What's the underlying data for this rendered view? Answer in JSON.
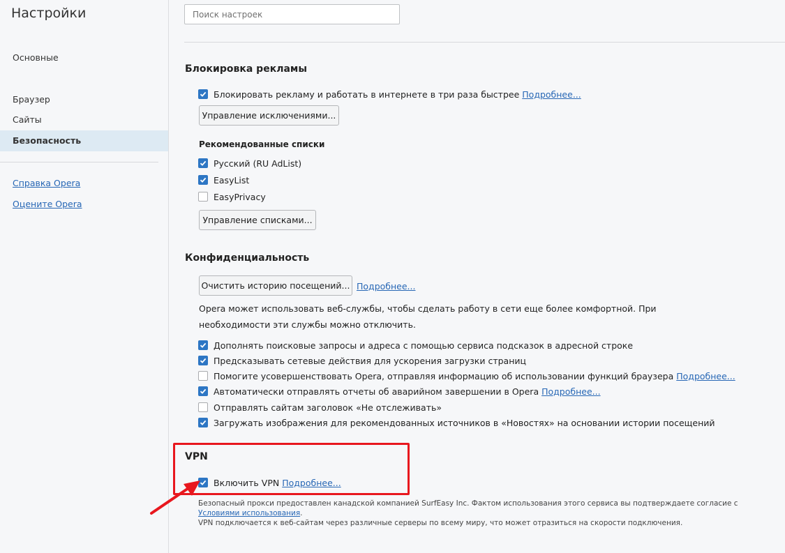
{
  "sidebar": {
    "title": "Настройки",
    "items": [
      {
        "label": "Основные"
      },
      {
        "label": "Браузер"
      },
      {
        "label": "Сайты"
      },
      {
        "label": "Безопасность",
        "active": true
      }
    ],
    "links": [
      {
        "label": "Справка Opera"
      },
      {
        "label": "Оцените Opera"
      }
    ]
  },
  "search": {
    "placeholder": "Поиск настроек",
    "value": ""
  },
  "adblock": {
    "title": "Блокировка рекламы",
    "block_ads": {
      "label": "Блокировать рекламу и работать в интернете в три раза быстрее",
      "checked": true,
      "link": "Подробнее..."
    },
    "manage_exceptions_button": "Управление исключениями...",
    "lists_title": "Рекомендованные списки",
    "lists": [
      {
        "label": "Русский (RU AdList)",
        "checked": true
      },
      {
        "label": "EasyList",
        "checked": true
      },
      {
        "label": "EasyPrivacy",
        "checked": false
      }
    ],
    "manage_lists_button": "Управление списками..."
  },
  "privacy": {
    "title": "Конфиденциальность",
    "clear_history_button": "Очистить историю посещений...",
    "clear_history_link": "Подробнее...",
    "description": "Opera может использовать веб-службы, чтобы сделать работу в сети еще более комфортной. При необходимости эти службы можно отключить.",
    "options": [
      {
        "label": "Дополнять поисковые запросы и адреса с помощью сервиса подсказок в адресной строке",
        "checked": true,
        "link": ""
      },
      {
        "label": "Предсказывать сетевые действия для ускорения загрузки страниц",
        "checked": true,
        "link": ""
      },
      {
        "label": "Помогите усовершенствовать Opera, отправляя информацию об использовании функций браузера",
        "checked": false,
        "link": "Подробнее..."
      },
      {
        "label": "Автоматически отправлять отчеты об аварийном завершении в Opera",
        "checked": true,
        "link": "Подробнее..."
      },
      {
        "label": "Отправлять сайтам заголовок «Не отслеживать»",
        "checked": false,
        "link": ""
      },
      {
        "label": "Загружать изображения для рекомендованных источников в «Новостях» на основании истории посещений",
        "checked": true,
        "link": ""
      }
    ]
  },
  "vpn": {
    "title": "VPN",
    "enable": {
      "label": "Включить VPN",
      "checked": true,
      "link": "Подробнее..."
    },
    "note1": "Безопасный прокси предоставлен канадской компанией SurfEasy Inc. Фактом использования этого сервиса вы подтверждаете согласие с",
    "terms_link": "Условиями использования",
    "terms_suffix": ".",
    "note2": "VPN подключается к веб-сайтам через различные серверы по всему миру, что может отразиться на скорости подключения."
  },
  "colors": {
    "accent": "#2d76c4",
    "link": "#2767b5",
    "highlight": "#e8171e",
    "active_nav_bg": "#ddeaf3"
  }
}
